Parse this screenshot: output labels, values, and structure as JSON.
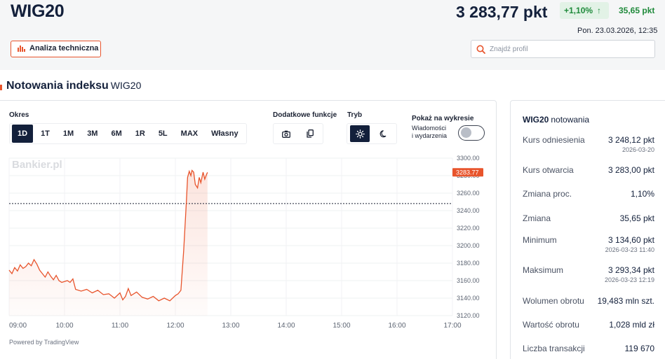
{
  "header": {
    "title": "WIG20",
    "price": "3 283,77 pkt",
    "change_pct": "+1,10%",
    "change_abs": "35,65 pkt",
    "datetime": "Pon. 23.03.2026, 12:35",
    "ta_button": "Analiza techniczna",
    "search_placeholder": "Znajdź profil"
  },
  "section": {
    "title": "Notowania indeksu",
    "subtitle": "WIG20"
  },
  "controls": {
    "period_label": "Okres",
    "periods": [
      "1D",
      "1T",
      "1M",
      "3M",
      "6M",
      "1R",
      "5L",
      "MAX",
      "Własny"
    ],
    "active_period": "1D",
    "extra_label": "Dodatkowe funkcje",
    "mode_label": "Tryb",
    "show_label": "Pokaż na wykresie",
    "news_label_1": "Wiadomości",
    "news_label_2": "i wydarzenia",
    "news_toggle": false
  },
  "chart_data": {
    "type": "area",
    "watermark": "Bankier.pl",
    "x_ticks": [
      "09:00",
      "10:00",
      "11:00",
      "12:00",
      "13:00",
      "14:00",
      "15:00",
      "16:00",
      "17:00"
    ],
    "y_ticks": [
      "3300.00",
      "3280.00",
      "3260.00",
      "3240.00",
      "3220.00",
      "3200.00",
      "3180.00",
      "3160.00",
      "3140.00",
      "3120.00"
    ],
    "ylim": [
      3120,
      3300
    ],
    "reference_line": 3248.12,
    "last_value_label": "3283.77",
    "line_color": "#e8542c",
    "series": [
      {
        "x": [
          9.0,
          9.05,
          9.1,
          9.15,
          9.2,
          9.25,
          9.3,
          9.35,
          9.4,
          9.45,
          9.5,
          9.55,
          9.6,
          9.65,
          9.7,
          9.75,
          9.8,
          9.85,
          9.9,
          9.95,
          10.0,
          10.05,
          10.1,
          10.15,
          10.2,
          10.3,
          10.4,
          10.5,
          10.6,
          10.7,
          10.8,
          10.9,
          11.0,
          11.05,
          11.1,
          11.15,
          11.2,
          11.3,
          11.4,
          11.5,
          11.6,
          11.7,
          11.8,
          11.9,
          12.0,
          12.05,
          12.1,
          12.15,
          12.2,
          12.22,
          12.25,
          12.28,
          12.3,
          12.33,
          12.36,
          12.4,
          12.43,
          12.46,
          12.5,
          12.53,
          12.56,
          12.58
        ],
        "y": [
          3172,
          3168,
          3175,
          3171,
          3178,
          3174,
          3176,
          3180,
          3177,
          3184,
          3179,
          3172,
          3168,
          3164,
          3170,
          3165,
          3161,
          3166,
          3160,
          3158,
          3159,
          3160,
          3158,
          3162,
          3150,
          3148,
          3150,
          3146,
          3149,
          3144,
          3145,
          3140,
          3146,
          3138,
          3142,
          3151,
          3143,
          3147,
          3141,
          3139,
          3142,
          3137,
          3140,
          3137,
          3143,
          3145,
          3149,
          3195,
          3252,
          3278,
          3285,
          3280,
          3286,
          3284,
          3270,
          3266,
          3278,
          3272,
          3284,
          3276,
          3281,
          3283.77
        ]
      }
    ]
  },
  "powered_by": "Powered by TradingView",
  "stats": {
    "title": "WIG20",
    "subtitle": "notowania",
    "rows": [
      {
        "label": "Kurs odniesienia",
        "value": "3 248,12 pkt",
        "date": "2026-03-20"
      },
      {
        "label": "Kurs otwarcia",
        "value": "3 283,00 pkt",
        "date": ""
      },
      {
        "label": "Zmiana proc.",
        "value": "1,10%",
        "date": ""
      },
      {
        "label": "Zmiana",
        "value": "35,65 pkt",
        "date": ""
      },
      {
        "label": "Minimum",
        "value": "3 134,60 pkt",
        "date": "2026-03-23 11:40"
      },
      {
        "label": "Maksimum",
        "value": "3 293,34 pkt",
        "date": "2026-03-23 12:19"
      },
      {
        "label": "Wolumen obrotu",
        "value": "19,483 mln szt.",
        "date": ""
      },
      {
        "label": "Wartość obrotu",
        "value": "1,028 mld zł",
        "date": ""
      },
      {
        "label": "Liczba transakcji",
        "value": "119 670",
        "date": ""
      }
    ]
  }
}
